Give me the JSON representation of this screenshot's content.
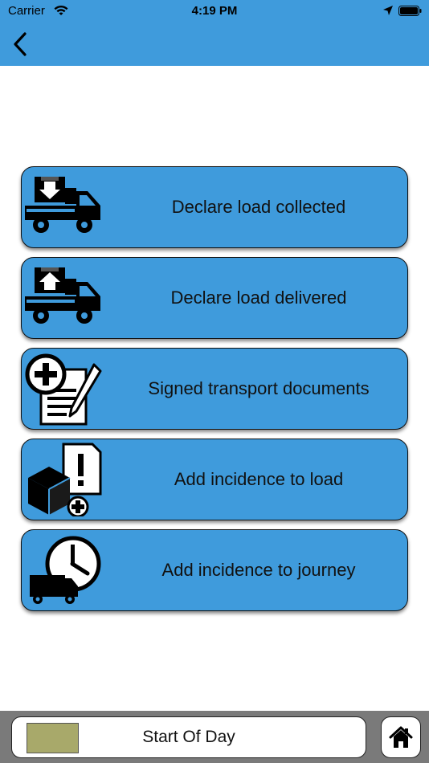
{
  "status_bar": {
    "carrier": "Carrier",
    "time": "4:19 PM"
  },
  "nav": {
    "back_icon": "chevron-left-icon",
    "color": "#3f9bdc"
  },
  "actions": [
    {
      "label": "Declare load collected",
      "icon": "truck-load-down-icon"
    },
    {
      "label": "Declare load delivered",
      "icon": "truck-load-up-icon"
    },
    {
      "label": "Signed transport documents",
      "icon": "document-sign-icon"
    },
    {
      "label": "Add incidence to load",
      "icon": "box-alert-icon"
    },
    {
      "label": "Add incidence to journey",
      "icon": "clock-truck-icon"
    }
  ],
  "bottom": {
    "start_label": "Start Of Day",
    "status_swatch_color": "#a8a96a",
    "home_icon": "home-icon"
  }
}
